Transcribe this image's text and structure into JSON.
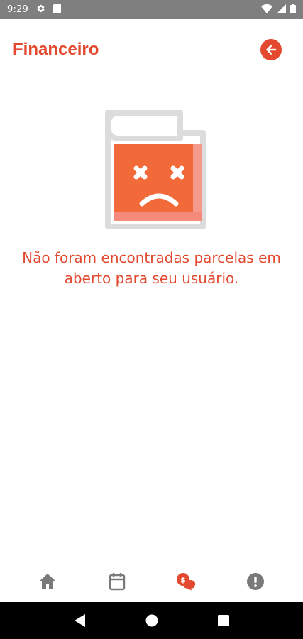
{
  "status_bar": {
    "time": "9:29",
    "icons_left": [
      "gear-icon",
      "sd-card-icon"
    ],
    "icons_right": [
      "wifi-icon",
      "cellular-signal-icon",
      "battery-icon"
    ]
  },
  "header": {
    "title": "Financeiro",
    "back_icon": "arrow-left-circle-icon"
  },
  "empty_state": {
    "illustration": "sad-book-icon",
    "message": "Não foram encontradas parcelas em aberto para seu usuário."
  },
  "bottom_nav": {
    "items": [
      {
        "icon": "home-icon",
        "active": false
      },
      {
        "icon": "calendar-icon",
        "active": false
      },
      {
        "icon": "finance-chat-icon",
        "active": true
      },
      {
        "icon": "alert-icon",
        "active": false
      }
    ]
  },
  "system_nav": [
    "back-triangle-icon",
    "home-circle-icon",
    "recents-square-icon"
  ],
  "colors": {
    "accent": "#e2492f",
    "book_cover": "#f26a3a",
    "book_frame": "#dcdcdc",
    "icon_inactive": "#7a7a7a",
    "status_bar": "#7f7f7f"
  }
}
